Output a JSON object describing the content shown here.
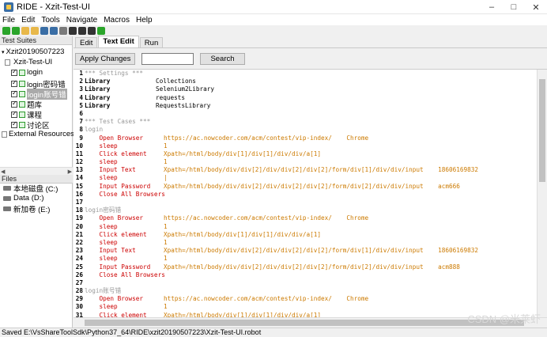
{
  "window": {
    "title": "RIDE - Xzit-Test-UI"
  },
  "menubar": [
    "File",
    "Edit",
    "Tools",
    "Navigate",
    "Macros",
    "Help"
  ],
  "toolbar": {
    "buttons": [
      {
        "icon": "back-icon",
        "color": "#2aa52a"
      },
      {
        "icon": "forward-icon",
        "color": "#2aa52a"
      },
      {
        "icon": "open-folder-icon",
        "color": "#e8b84a"
      },
      {
        "icon": "open-file-icon",
        "color": "#e8b84a"
      },
      {
        "icon": "save-icon",
        "color": "#3a6ea5"
      },
      {
        "icon": "save-all-icon",
        "color": "#3a6ea5"
      },
      {
        "icon": "copy-icon",
        "color": "#7a7a7a"
      },
      {
        "icon": "keyword-icon",
        "color": "#333333"
      },
      {
        "icon": "text-icon",
        "color": "#333333"
      },
      {
        "icon": "run-icon",
        "color": "#333333"
      },
      {
        "icon": "settings-icon",
        "color": "#2aa52a"
      }
    ]
  },
  "left_panel": {
    "suites_header": "Test Suites",
    "tree": [
      {
        "label": "Xzit20190507223",
        "level": 0,
        "kind": "project"
      },
      {
        "label": "Xzit-Test-UI",
        "level": 1,
        "kind": "suite"
      },
      {
        "label": "login",
        "level": 2,
        "kind": "test"
      },
      {
        "label": "login密码错",
        "level": 2,
        "kind": "test"
      },
      {
        "label": "login账号错",
        "level": 2,
        "kind": "test",
        "selected": true
      },
      {
        "label": "题库",
        "level": 2,
        "kind": "test"
      },
      {
        "label": "课程",
        "level": 2,
        "kind": "test"
      },
      {
        "label": "讨论区",
        "level": 2,
        "kind": "test"
      },
      {
        "label": "External Resources",
        "level": 0,
        "kind": "external"
      }
    ],
    "files_header": "Files",
    "drives": [
      "本地磁盘 (C:)",
      "Data (D:)",
      "新加卷 (E:)"
    ]
  },
  "editor": {
    "tabs": [
      {
        "label": "Edit",
        "active": false
      },
      {
        "label": "Text Edit",
        "active": true
      },
      {
        "label": "Run",
        "active": false
      }
    ],
    "apply_changes": "Apply Changes",
    "search_button": "Search",
    "search_value": "",
    "lines": [
      {
        "n": "1",
        "text": "*** Settings ***",
        "style": "section"
      },
      {
        "n": "2",
        "kw": "Library",
        "text": "Collections"
      },
      {
        "n": "3",
        "kw": "Library",
        "text": "Selenium2Library"
      },
      {
        "n": "4",
        "kw": "Library",
        "text": "requests"
      },
      {
        "n": "5",
        "kw": "Library",
        "text": "RequestsLibrary"
      },
      {
        "n": "6",
        "text": ""
      },
      {
        "n": "7",
        "text": "*** Test Cases ***",
        "style": "section"
      },
      {
        "n": "8",
        "text": "login",
        "style": "test"
      },
      {
        "n": "9",
        "kw": "    Open Browser",
        "text": "https://ac.nowcoder.com/acm/contest/vip-index/    Chrome"
      },
      {
        "n": "10",
        "kw": "    sleep",
        "text": "1"
      },
      {
        "n": "11",
        "kw": "    Click element",
        "text": "Xpath=/html/body/div[1]/div[1]/div/div/a[1]"
      },
      {
        "n": "12",
        "kw": "    sleep",
        "text": "1"
      },
      {
        "n": "13",
        "kw": "    Input Text",
        "text": "Xpath=/html/body/div/div[2]/div/div[2]/div[2]/form/div[1]/div/div/input    18606169832"
      },
      {
        "n": "14",
        "kw": "    sleep",
        "text": "|"
      },
      {
        "n": "15",
        "kw": "    Input Password",
        "text": "Xpath=/html/body/div/div[2]/div/div[2]/div[2]/form/div[2]/div/div/input    acm666"
      },
      {
        "n": "16",
        "kw": "    Close All Browsers",
        "text": ""
      },
      {
        "n": "17",
        "text": ""
      },
      {
        "n": "18",
        "text": "login密码错",
        "style": "test"
      },
      {
        "n": "19",
        "kw": "    Open Browser",
        "text": "https://ac.nowcoder.com/acm/contest/vip-index/    Chrome"
      },
      {
        "n": "20",
        "kw": "    sleep",
        "text": "1"
      },
      {
        "n": "21",
        "kw": "    Click element",
        "text": "Xpath=/html/body/div[1]/div[1]/div/div/a[1]"
      },
      {
        "n": "22",
        "kw": "    sleep",
        "text": "1"
      },
      {
        "n": "23",
        "kw": "    Input Text",
        "text": "Xpath=/html/body/div/div[2]/div/div[2]/div[2]/form/div[1]/div/div/input    18606169832"
      },
      {
        "n": "24",
        "kw": "    sleep",
        "text": "1"
      },
      {
        "n": "25",
        "kw": "    Input Password",
        "text": "Xpath=/html/body/div/div[2]/div/div[2]/div[2]/form/div[2]/div/div/input    acm888"
      },
      {
        "n": "26",
        "kw": "    Close All Browsers",
        "text": ""
      },
      {
        "n": "27",
        "text": ""
      },
      {
        "n": "28",
        "text": "login账号错",
        "style": "test"
      },
      {
        "n": "29",
        "kw": "    Open Browser",
        "text": "https://ac.nowcoder.com/acm/contest/vip-index/    Chrome"
      },
      {
        "n": "30",
        "kw": "    sleep",
        "text": "1"
      },
      {
        "n": "31",
        "kw": "    Click element",
        "text": "Xpath=/html/body/div[1]/div[1]/div/div/a[1]"
      }
    ]
  },
  "status": "Saved E:\\VsShareToolSdk\\Python37_64\\RIDE\\xzit20190507223\\Xzit-Test-UI.robot",
  "watermark": "CSDN @米莱虾"
}
